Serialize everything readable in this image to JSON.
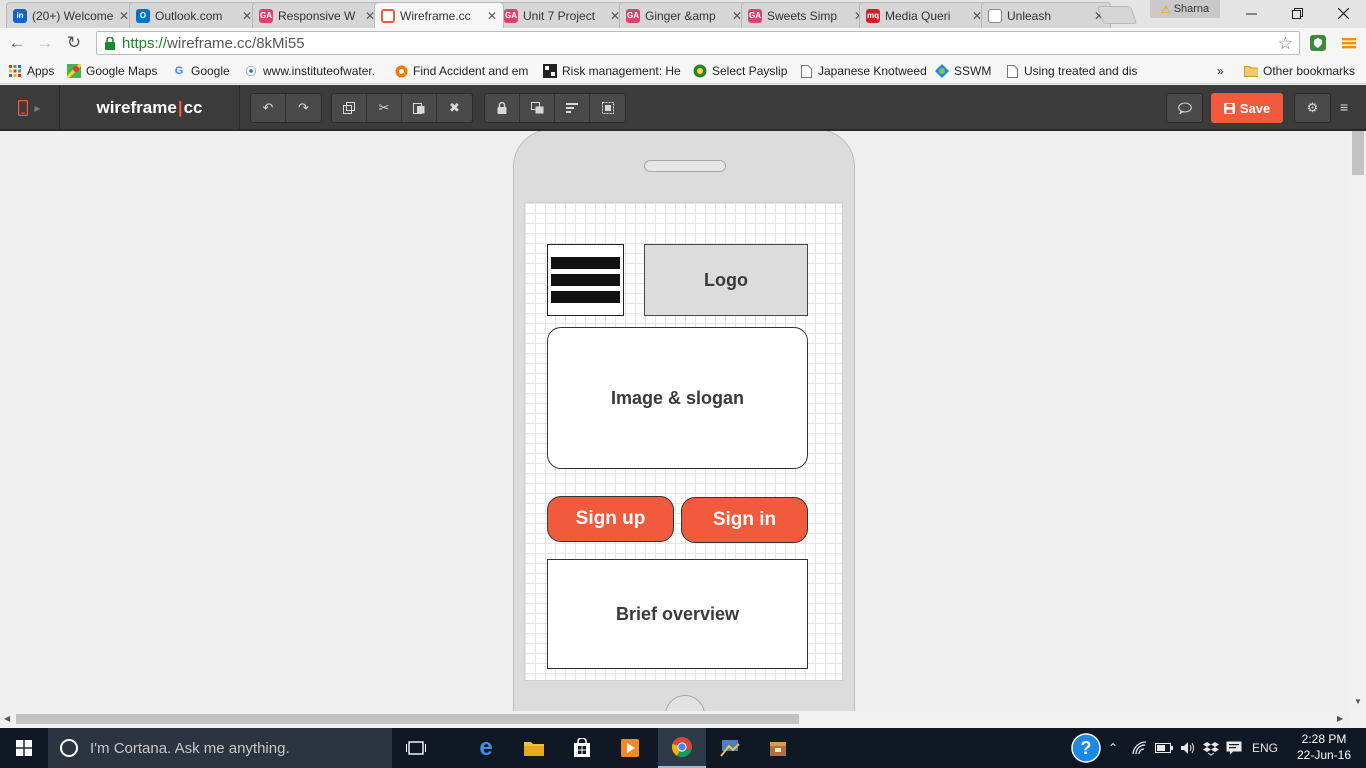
{
  "browser": {
    "tabs": [
      {
        "title": "(20+) Welcome",
        "favicon": "linkedin-icon",
        "color": "#0a66c2",
        "glyph": "in"
      },
      {
        "title": "Outlook.com",
        "favicon": "outlook-icon",
        "color": "#0072c6",
        "glyph": "O"
      },
      {
        "title": "Responsive W",
        "favicon": "ga-icon",
        "color": "#d6456b",
        "glyph": "GA"
      },
      {
        "title": "Wireframe.cc",
        "favicon": "wireframe-icon",
        "color": "#f25a3e",
        "glyph": ""
      },
      {
        "title": "Unit 7 Project",
        "favicon": "ga-icon",
        "color": "#d6456b",
        "glyph": "GA"
      },
      {
        "title": "Ginger &amp",
        "favicon": "ga-icon",
        "color": "#d6456b",
        "glyph": "GA"
      },
      {
        "title": "Sweets Simp",
        "favicon": "ga-icon",
        "color": "#d6456b",
        "glyph": "GA"
      },
      {
        "title": "Media Queri",
        "favicon": "mq-icon",
        "color": "#c7252b",
        "glyph": "mq"
      },
      {
        "title": "Unleash",
        "favicon": "page-icon",
        "color": "#ffffff",
        "glyph": ""
      }
    ],
    "active_tab_index": 3,
    "user_name": "Sharna",
    "url_scheme": "https://",
    "url_rest": "wireframe.cc/8kMi55",
    "bookmarks": [
      {
        "label": "Apps",
        "icon": "apps-grid-icon"
      },
      {
        "label": "Google Maps",
        "icon": "google-maps-icon"
      },
      {
        "label": "Google",
        "icon": "google-icon"
      },
      {
        "label": "www.instituteofwater.",
        "icon": "institute-icon"
      },
      {
        "label": "Find Accident and em",
        "icon": "accident-icon"
      },
      {
        "label": "Risk management: He",
        "icon": "risk-icon"
      },
      {
        "label": "Select Payslip",
        "icon": "payslip-icon"
      },
      {
        "label": "Japanese Knotweed",
        "icon": "page-icon"
      },
      {
        "label": "SSWM",
        "icon": "sswm-icon"
      },
      {
        "label": "Using treated and dis",
        "icon": "page-icon"
      }
    ],
    "more_bookmarks": "»",
    "other_bookmarks": "Other bookmarks"
  },
  "app": {
    "logo_left": "wireframe",
    "logo_sep": "|",
    "logo_right": "cc",
    "save_label": "Save",
    "accent": "#f25a3e"
  },
  "wireframe": {
    "logo": "Logo",
    "hero": "Image & slogan",
    "signup": "Sign up",
    "signin": "Sign in",
    "overview": "Brief overview"
  },
  "taskbar": {
    "cortana_placeholder": "I'm Cortana. Ask me anything.",
    "language": "ENG",
    "time": "2:28 PM",
    "date": "22-Jun-16"
  }
}
